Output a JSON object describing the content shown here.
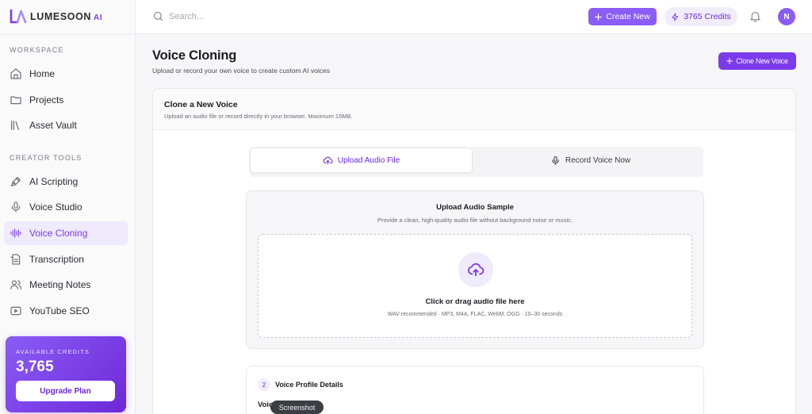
{
  "brand": {
    "name": "LUMESOON",
    "suffix": "AI"
  },
  "sidebar": {
    "sections": [
      {
        "label": "WORKSPACE"
      },
      {
        "label": "CREATOR TOOLS"
      }
    ],
    "items": [
      {
        "label": "Home",
        "icon": "home-icon"
      },
      {
        "label": "Projects",
        "icon": "folder-icon"
      },
      {
        "label": "Asset Vault",
        "icon": "library-icon"
      },
      {
        "label": "AI Scripting",
        "icon": "pen-icon"
      },
      {
        "label": "Voice Studio",
        "icon": "mic-icon"
      },
      {
        "label": "Voice Cloning",
        "icon": "audio-lines-icon",
        "active": true
      },
      {
        "label": "Transcription",
        "icon": "document-icon"
      },
      {
        "label": "Meeting Notes",
        "icon": "users-icon"
      },
      {
        "label": "YouTube SEO",
        "icon": "youtube-icon"
      }
    ],
    "credits": {
      "label": "AVAILABLE CREDITS",
      "value": "3,765",
      "button": "Upgrade Plan"
    }
  },
  "topbar": {
    "search_placeholder": "Search...",
    "create_label": "Create New",
    "credits_label": "3765 Credits",
    "avatar_initial": "N"
  },
  "main": {
    "title": "Voice Cloning",
    "subtitle": "Upload or record your own voice to create custom AI voices",
    "clone_button": "Clone New Voice",
    "card": {
      "title": "Clone a New Voice",
      "subtitle": "Upload an audio file or record directly in your browser. Maximum 15MB.",
      "tabs": [
        {
          "label": "Upload Audio File",
          "active": true
        },
        {
          "label": "Record Voice Now",
          "active": false
        }
      ],
      "upload": {
        "title": "Upload Audio Sample",
        "subtitle": "Provide a clean, high-quality audio file without background noise or music.",
        "drop_title": "Click or drag audio file here",
        "drop_hint": "WAV recommended · MP3, M4A, FLAC, WebM, OGG · 10–30 seconds"
      },
      "profile": {
        "step": "2",
        "title": "Voice Profile Details",
        "field_label": "Voic"
      }
    }
  },
  "tooltip": "Screenshot",
  "colors": {
    "accent": "#7c3aed",
    "accent_light": "#8b5cf6",
    "accent_bg": "#efeafc"
  }
}
